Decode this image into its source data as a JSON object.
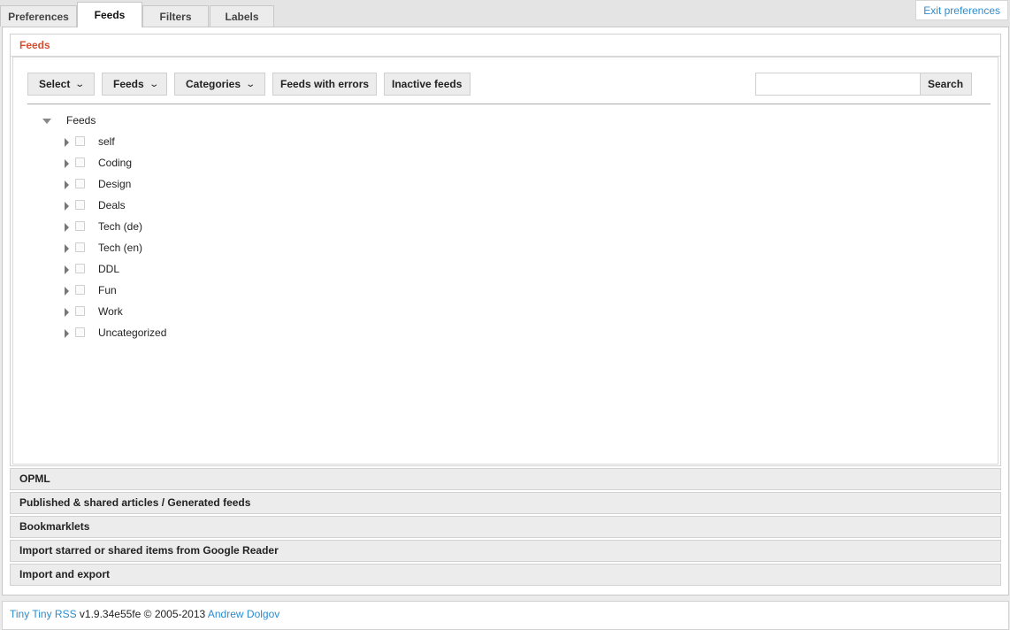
{
  "tabs": [
    {
      "label": "Preferences"
    },
    {
      "label": "Feeds",
      "active": true
    },
    {
      "label": "Filters"
    },
    {
      "label": "Labels"
    }
  ],
  "exit_label": "Exit preferences",
  "feeds_pane": {
    "title": "Feeds",
    "toolbar": {
      "select_label": "Select",
      "feeds_label": "Feeds",
      "categories_label": "Categories",
      "errors_label": "Feeds with errors",
      "inactive_label": "Inactive feeds",
      "search_value": "",
      "search_label": "Search"
    },
    "tree": {
      "root_label": "Feeds",
      "items": [
        {
          "label": "self"
        },
        {
          "label": "Coding"
        },
        {
          "label": "Design"
        },
        {
          "label": "Deals"
        },
        {
          "label": "Tech (de)"
        },
        {
          "label": "Tech (en)"
        },
        {
          "label": "DDL"
        },
        {
          "label": "Fun"
        },
        {
          "label": "Work"
        },
        {
          "label": "Uncategorized"
        }
      ]
    }
  },
  "sections": [
    {
      "label": "OPML"
    },
    {
      "label": "Published & shared articles / Generated feeds"
    },
    {
      "label": "Bookmarklets"
    },
    {
      "label": "Import starred or shared items from Google Reader"
    },
    {
      "label": "Import and export"
    }
  ],
  "footer": {
    "app_name": "Tiny Tiny RSS",
    "version_text": " v1.9.34e55fe © 2005-2013 ",
    "author": "Andrew Dolgov"
  },
  "colors": {
    "accent_link": "#2d8ccc",
    "pane_title": "#d44d2e"
  }
}
